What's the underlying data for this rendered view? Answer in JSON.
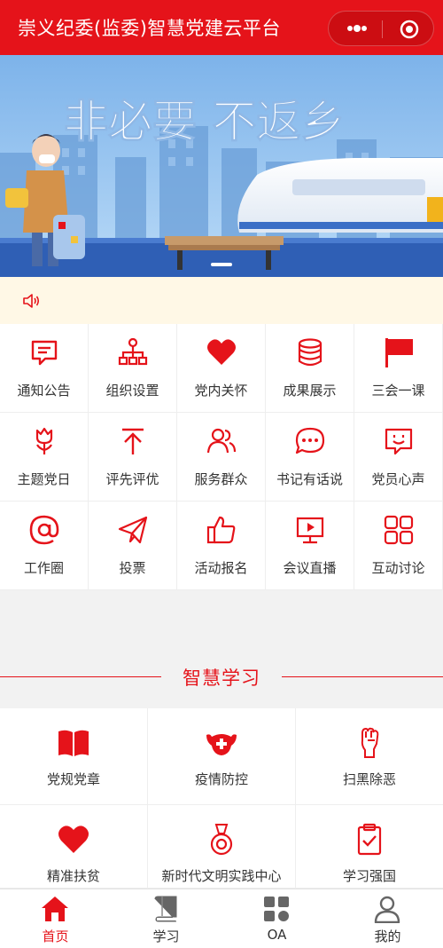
{
  "header": {
    "title": "崇义纪委(监委)智慧党建云平台",
    "capsule_icons": [
      "more-dots-icon",
      "target-circle-icon"
    ]
  },
  "banner": {
    "headline": "非必要 不返乡"
  },
  "notice": {
    "icon": "speaker-icon",
    "text": ""
  },
  "menu": [
    {
      "label": "通知公告",
      "icon": "message-board-icon"
    },
    {
      "label": "组织设置",
      "icon": "org-tree-icon"
    },
    {
      "label": "党内关怀",
      "icon": "heart-icon"
    },
    {
      "label": "成果展示",
      "icon": "database-icon"
    },
    {
      "label": "三会一课",
      "icon": "flag-icon"
    },
    {
      "label": "主题党日",
      "icon": "tulip-icon"
    },
    {
      "label": "评先评优",
      "icon": "arrow-up-icon"
    },
    {
      "label": "服务群众",
      "icon": "people-icon"
    },
    {
      "label": "书记有话说",
      "icon": "chat-bubble-icon"
    },
    {
      "label": "党员心声",
      "icon": "smile-message-icon"
    },
    {
      "label": "工作圈",
      "icon": "at-sign-icon"
    },
    {
      "label": "投票",
      "icon": "paper-plane-icon"
    },
    {
      "label": "活动报名",
      "icon": "thumbs-up-icon"
    },
    {
      "label": "会议直播",
      "icon": "live-screen-icon"
    },
    {
      "label": "互动讨论",
      "icon": "grid-squares-icon"
    }
  ],
  "study_section": {
    "title": "智慧学习",
    "items": [
      {
        "label": "党规党章",
        "icon": "open-book-icon"
      },
      {
        "label": "疫情防控",
        "icon": "mask-cross-icon"
      },
      {
        "label": "扫黑除恶",
        "icon": "raised-fist-icon"
      },
      {
        "label": "精准扶贫",
        "icon": "heart-icon"
      },
      {
        "label": "新时代文明实践中心",
        "icon": "medal-icon"
      },
      {
        "label": "学习强国",
        "icon": "clipboard-check-icon"
      }
    ]
  },
  "tabbar": {
    "active": 0,
    "tabs": [
      {
        "label": "首页",
        "icon": "home-icon"
      },
      {
        "label": "学习",
        "icon": "book-icon"
      },
      {
        "label": "OA",
        "icon": "apps-icon"
      },
      {
        "label": "我的",
        "icon": "user-icon"
      }
    ]
  },
  "colors": {
    "brand_red": "#e5131a",
    "notice_bg": "#fff8e6",
    "banner_sky": "#86b8ea"
  }
}
